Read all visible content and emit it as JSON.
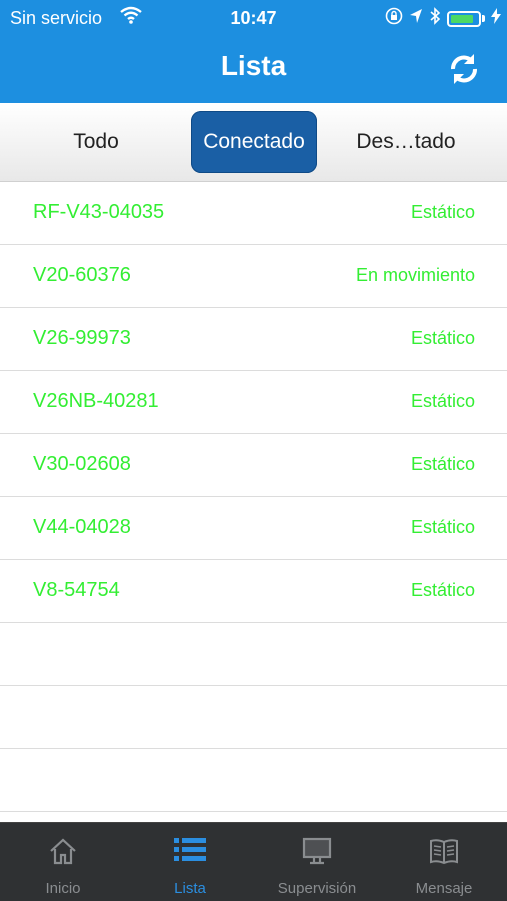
{
  "status_bar": {
    "carrier": "Sin servicio",
    "time": "10:47",
    "battery_level": 0.85
  },
  "header": {
    "title": "Lista",
    "refresh_icon": "refresh-icon"
  },
  "segments": [
    {
      "label": "Todo",
      "active": false
    },
    {
      "label": "Conectado",
      "active": true
    },
    {
      "label": "Des…tado",
      "active": false
    }
  ],
  "devices": [
    {
      "name": "RF-V43-04035",
      "status": "Estático"
    },
    {
      "name": "V20-60376",
      "status": "En movimiento"
    },
    {
      "name": "V26-99973",
      "status": "Estático"
    },
    {
      "name": "V26NB-40281",
      "status": "Estático"
    },
    {
      "name": "V30-02608",
      "status": "Estático"
    },
    {
      "name": "V44-04028",
      "status": "Estático"
    },
    {
      "name": "V8-54754",
      "status": "Estático"
    }
  ],
  "tabbar": [
    {
      "label": "Inicio",
      "icon": "home-icon",
      "active": false
    },
    {
      "label": "Lista",
      "icon": "list-icon",
      "active": true
    },
    {
      "label": "Supervisión",
      "icon": "monitor-icon",
      "active": false
    },
    {
      "label": "Mensaje",
      "icon": "book-icon",
      "active": false
    }
  ],
  "colors": {
    "header_bg": "#1d8fe0",
    "segment_active": "#1a5fa5",
    "status_green": "#33ee33",
    "tab_active": "#2b8ee0",
    "tabbar_bg": "#2f3133"
  }
}
